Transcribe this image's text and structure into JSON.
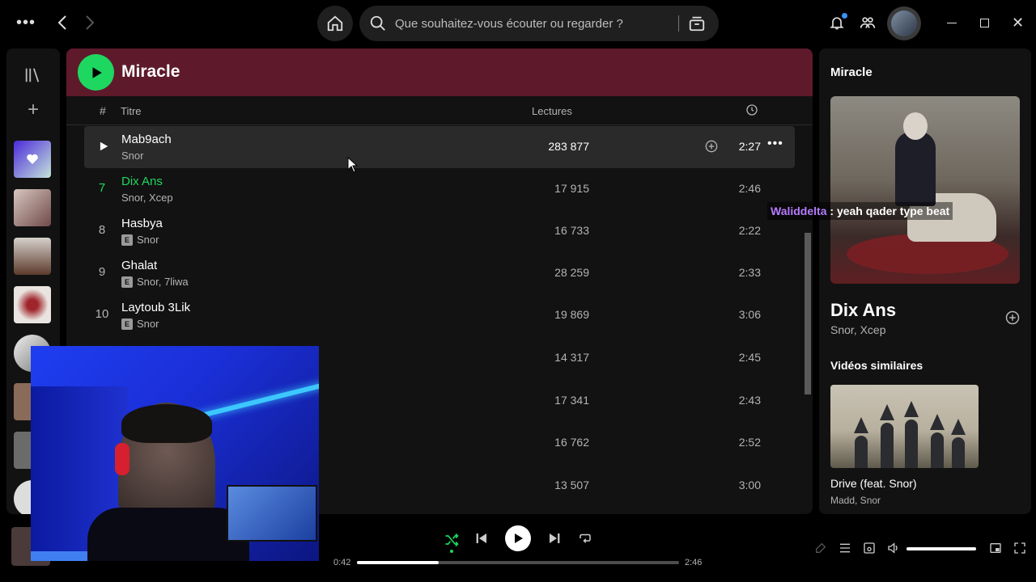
{
  "topbar": {
    "search_placeholder": "Que souhaitez-vous écouter ou regarder ?"
  },
  "main": {
    "title": "Miracle",
    "columns": {
      "number": "#",
      "title": "Titre",
      "plays": "Lectures"
    },
    "tracks": [
      {
        "number": "",
        "title": "Mab9ach",
        "artists": "Snor",
        "explicit": false,
        "plays": "283 877",
        "duration": "2:27",
        "hovered": true
      },
      {
        "number": "7",
        "title": "Dix Ans",
        "artists": "Snor, Xcep",
        "explicit": false,
        "plays": "17 915",
        "duration": "2:46",
        "playing": true
      },
      {
        "number": "8",
        "title": "Hasbya",
        "artists": "Snor",
        "explicit": true,
        "plays": "16 733",
        "duration": "2:22"
      },
      {
        "number": "9",
        "title": "Ghalat",
        "artists": "Snor, 7liwa",
        "explicit": true,
        "plays": "28 259",
        "duration": "2:33"
      },
      {
        "number": "10",
        "title": "Laytoub 3Lik",
        "artists": "Snor",
        "explicit": true,
        "plays": "19 869",
        "duration": "3:06"
      },
      {
        "number": "",
        "title": "",
        "artists": "",
        "explicit": false,
        "plays": "14 317",
        "duration": "2:45"
      },
      {
        "number": "",
        "title": "",
        "artists": "",
        "explicit": false,
        "plays": "17 341",
        "duration": "2:43"
      },
      {
        "number": "",
        "title": "",
        "artists": "",
        "explicit": false,
        "plays": "16 762",
        "duration": "2:52"
      },
      {
        "number": "",
        "title": "",
        "artists": "",
        "explicit": false,
        "plays": "13 507",
        "duration": "3:00"
      }
    ],
    "explicit_label": "E"
  },
  "right_panel": {
    "header": "Miracle",
    "track_title": "Dix Ans",
    "track_artists": "Snor, Xcep",
    "similar_heading": "Vidéos similaires",
    "similar_video": {
      "title": "Drive (feat. Snor)",
      "artists": "Madd, Snor"
    }
  },
  "chat": {
    "user": "Waliddelta",
    "message": " : yeah qader type beat"
  },
  "player": {
    "current_time": "0:42",
    "total_time": "2:46",
    "progress": 0.253,
    "volume": 1.0,
    "shuffle_active": true
  },
  "colors": {
    "accent": "#1ed760",
    "header_bg": "#5e1a2b",
    "chat_user": "#b77bff"
  }
}
